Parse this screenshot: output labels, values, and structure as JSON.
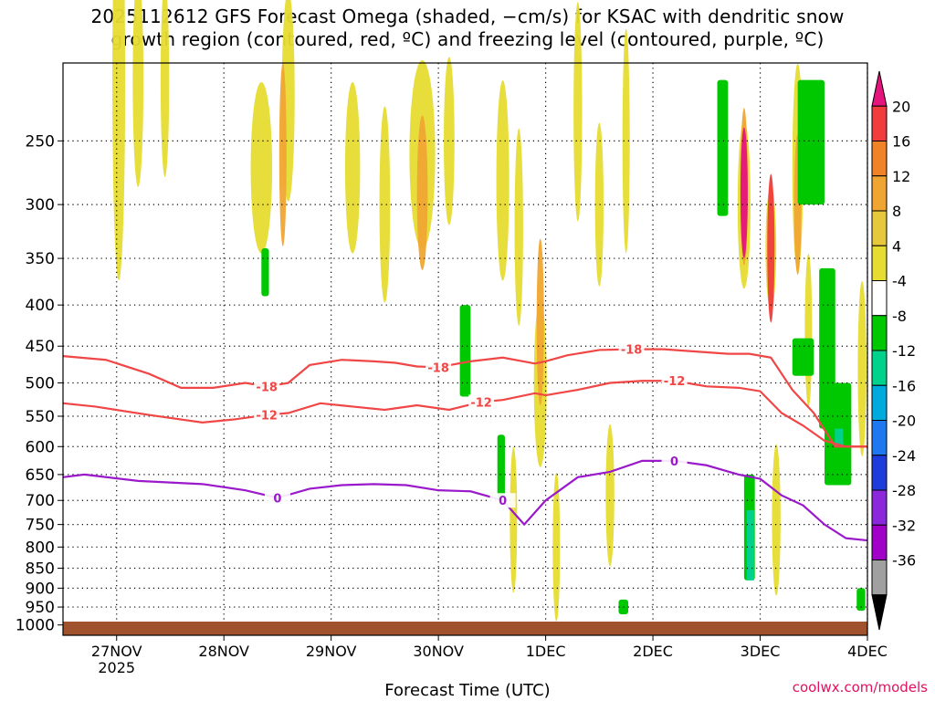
{
  "title": {
    "line1": "2025112612 GFS Forecast Omega (shaded, −cm/s) for KSAC with dendritic snow",
    "line2": "growth region (contoured, red, ºC) and freezing level (contoured, purple, ºC)"
  },
  "credit": "coolwx.com/models",
  "chart_data": {
    "type": "heatmap",
    "title": "2025112612 GFS Forecast Omega (shaded, −cm/s) for KSAC with dendritic snow growth region (contoured, red, ºC) and freezing level (contoured, purple, ºC)",
    "xlabel": "Forecast Time (UTC)",
    "ylabel": "",
    "x_ticks": [
      "27NOV",
      "28NOV",
      "29NOV",
      "30NOV",
      "1DEC",
      "2DEC",
      "3DEC",
      "4DEC"
    ],
    "x_year_label": "2025",
    "xlim_days": [
      -0.5,
      7.0
    ],
    "y_ticks": [
      250,
      300,
      350,
      400,
      450,
      500,
      550,
      600,
      650,
      700,
      750,
      800,
      850,
      900,
      950,
      1000
    ],
    "ylim_hpa": [
      1030,
      200
    ],
    "y_scale": "log-pressure",
    "grid": "dotted",
    "colorbar": {
      "levels": [
        20,
        16,
        12,
        8,
        4,
        -4,
        -8,
        -12,
        -16,
        -20,
        -24,
        -28,
        -32,
        -36
      ],
      "colors": [
        "#e4157c",
        "#f03c3c",
        "#f08228",
        "#f0a532",
        "#e6c83c",
        "#e6dc32",
        "#ffffff",
        "#00c800",
        "#00d28c",
        "#00aadc",
        "#1e78f0",
        "#1e3cdc",
        "#8c28dc",
        "#a000c8",
        "#a0a0a0",
        "#000000"
      ]
    },
    "contours": [
      {
        "label": "-18",
        "color": "#f04646",
        "x_days": [
          -0.5,
          -0.1,
          0.3,
          0.6,
          0.9,
          1.2,
          1.4,
          1.6,
          1.8,
          2.1,
          2.4,
          2.6,
          2.8,
          3.0,
          3.3,
          3.6,
          3.9,
          4.0,
          4.2,
          4.5,
          4.8,
          5.1,
          5.4,
          5.7,
          5.9,
          6.1,
          6.3,
          6.5,
          6.7,
          7.0
        ],
        "pressure": [
          463,
          468,
          487,
          507,
          507,
          500,
          505,
          500,
          475,
          468,
          470,
          472,
          477,
          478,
          470,
          465,
          473,
          470,
          462,
          455,
          454,
          454,
          457,
          460,
          460,
          465,
          510,
          545,
          600,
          600
        ]
      },
      {
        "label": "-12",
        "color": "#f04646",
        "x_days": [
          -0.5,
          -0.2,
          0.3,
          0.8,
          1.1,
          1.4,
          1.6,
          1.9,
          2.2,
          2.5,
          2.8,
          3.1,
          3.4,
          3.6,
          3.9,
          4.0,
          4.3,
          4.6,
          4.9,
          5.2,
          5.5,
          5.8,
          6.0,
          6.2,
          6.4,
          6.6,
          6.8,
          7.0
        ],
        "pressure": [
          530,
          535,
          548,
          560,
          555,
          548,
          545,
          530,
          535,
          540,
          533,
          540,
          528,
          525,
          515,
          518,
          510,
          500,
          497,
          497,
          505,
          507,
          512,
          545,
          565,
          590,
          600,
          600
        ]
      },
      {
        "label": "0",
        "color": "#9a1acb",
        "x_days": [
          -0.5,
          -0.3,
          0.2,
          0.8,
          1.2,
          1.5,
          1.8,
          2.1,
          2.4,
          2.7,
          3.0,
          3.3,
          3.6,
          3.8,
          4.0,
          4.3,
          4.6,
          4.9,
          5.2,
          5.5,
          5.8,
          6.0,
          6.2,
          6.4,
          6.6,
          6.8,
          7.0
        ],
        "pressure": [
          655,
          650,
          662,
          668,
          680,
          695,
          677,
          670,
          668,
          670,
          680,
          682,
          700,
          750,
          700,
          655,
          645,
          625,
          625,
          633,
          650,
          658,
          690,
          710,
          750,
          780,
          785
        ]
      }
    ]
  }
}
